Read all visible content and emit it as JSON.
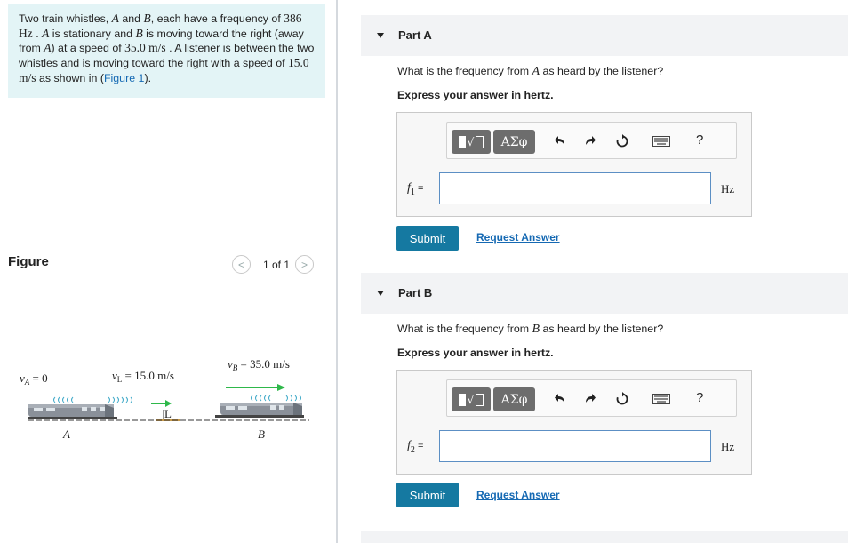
{
  "problem": {
    "seg1": "Two train whistles, ",
    "A": "A",
    "and": " and ",
    "B": "B",
    "seg2": ", each have a frequency of ",
    "freq": "386 Hz",
    "seg3": " . ",
    "A2": "A",
    "seg4": " is stationary and ",
    "B2": "B",
    "seg5": " is moving toward the right (away from ",
    "A3": "A",
    "seg6": ") at a speed of ",
    "speedB": "35.0 m/s",
    "seg7": " . A listener is between the two whistles and is moving toward the right with a speed of ",
    "speedL": "15.0 m/s",
    "seg8": " as shown in (",
    "figlink": "Figure 1",
    "seg9": ")."
  },
  "figure": {
    "title": "Figure",
    "pager_text": "1 of 1",
    "prev_glyph": "<",
    "next_glyph": ">",
    "vA": "v",
    "vA_sub": "A",
    "vA_val": " = 0",
    "vL": "v",
    "vL_sub": "L",
    "vL_val": " = 15.0 m/s",
    "vB": "v",
    "vB_sub": "B",
    "vB_val": " = 35.0 m/s",
    "labelA": "A",
    "labelB": "B",
    "labelL": "L"
  },
  "partA": {
    "title": "Part A",
    "q1": "What is the frequency from ",
    "qvar": "A",
    "q2": " as heard by the listener?",
    "express": "Express your answer in hertz.",
    "var": "f",
    "sub": "1",
    "eq": " =",
    "unit": "Hz",
    "submit": "Submit",
    "request": "Request Answer"
  },
  "partB": {
    "title": "Part B",
    "q1": "What is the frequency from ",
    "qvar": "B",
    "q2": " as heard by the listener?",
    "express": "Express your answer in hertz.",
    "var": "f",
    "sub": "2",
    "eq": " =",
    "unit": "Hz",
    "submit": "Submit",
    "request": "Request Answer"
  },
  "toolbar": {
    "templates_label": "√□",
    "symbols_label": "ΑΣφ",
    "help": "?",
    "icons": [
      "templates-icon",
      "symbols-icon",
      "undo-icon",
      "redo-icon",
      "reset-icon",
      "keyboard-icon",
      "help-icon"
    ]
  },
  "colors": {
    "problem_bg": "#e3f4f6",
    "link": "#1569b3",
    "submit_bg": "#1579a1",
    "arrow_green": "#2eb84a",
    "sound_waves": "#3fa9c8"
  }
}
